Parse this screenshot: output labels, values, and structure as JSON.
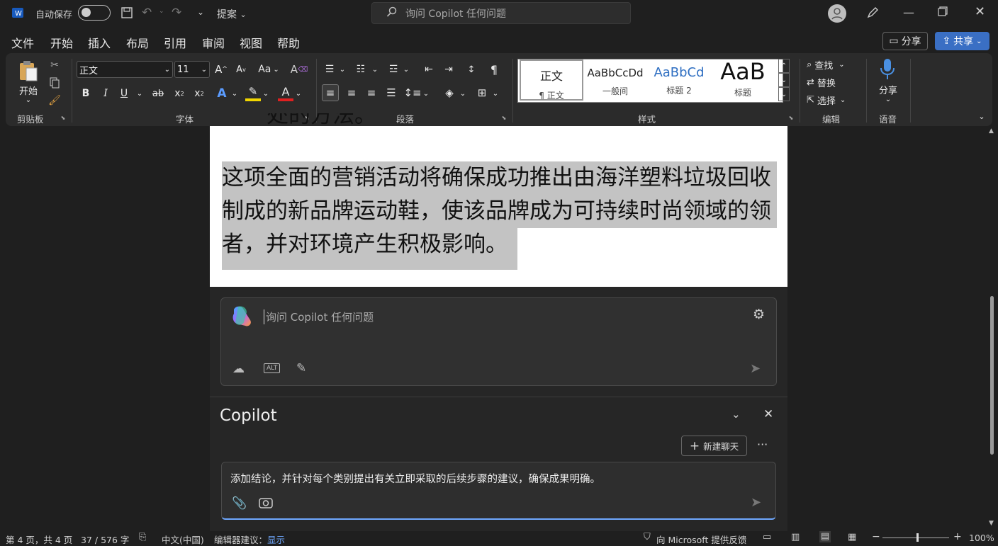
{
  "titlebar": {
    "autosave_label": "自动保存",
    "title_label": "提案",
    "search_placeholder": "询问 Copilot 任何问题"
  },
  "menu": {
    "items": [
      "文件",
      "开始",
      "插入",
      "布局",
      "引用",
      "审阅",
      "视图",
      "帮助"
    ],
    "active": "开始",
    "comments_label": "分享",
    "share_label": "共享"
  },
  "ribbon": {
    "paste_label": "开始",
    "clipboard_group": "剪贴板",
    "font_group": "字体",
    "paragraph_group": "段落",
    "styles_group": "样式",
    "editing_group": "编辑",
    "voice_group": "语音",
    "font_name": "正文",
    "font_size": "11",
    "case_label": "Aa",
    "styles": [
      {
        "preview": "正文",
        "name": "¶ 正文"
      },
      {
        "preview": "AaBbCcDd",
        "name": "一般间"
      },
      {
        "preview": "AaBbCd",
        "name": "标题 2"
      },
      {
        "preview": "AaB",
        "name": "标题"
      }
    ],
    "find_label": "查找",
    "replace_label": "替换",
    "select_label": "选择",
    "dictate_label": "分享"
  },
  "document": {
    "top_fragment": "处的方法。",
    "paragraph_line1": "这项全面的营销活动将确保成功推出由海洋塑料垃圾回收",
    "paragraph_line2": "制成的新品牌运动鞋，使该品牌成为可持续时尚领域的领",
    "paragraph_line3": "者，并对环境产生积极影响。"
  },
  "copilot": {
    "ask_placeholder": "询问 Copilot 任何问题",
    "panel_title": "Copilot",
    "new_chat_label": "新建聊天",
    "prompt_text": "添加结论，并针对每个类别提出有关立即采取的后续步骤的建议，确保成果明确。"
  },
  "status": {
    "page": "第 4 页，共 4 页",
    "words": "37 / 576 字",
    "language": "中文(中国)",
    "suggestions_label": "编辑器建议：",
    "suggestions_value": "显示",
    "feedback": "向 Microsoft 提供反馈",
    "zoom": "100%"
  },
  "colors": {
    "accent": "#6fa8ff",
    "share_button": "#3a6fc4",
    "highlight": "#c3c3c3"
  }
}
